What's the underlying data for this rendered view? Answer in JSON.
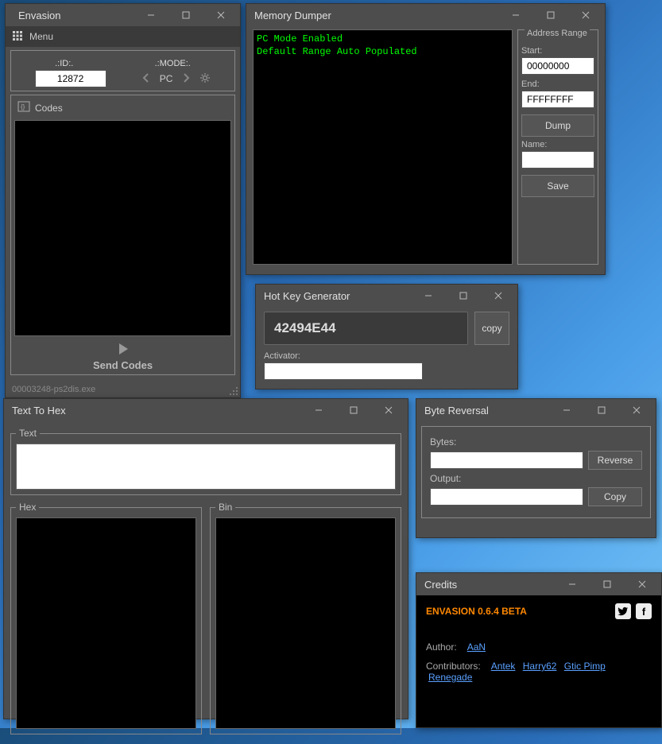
{
  "envasion": {
    "title": "Envasion",
    "menu": "Menu",
    "id_label": ".:ID:.",
    "mode_label": ".:MODE:.",
    "id_value": "12872",
    "mode_value": "PC",
    "codes_label": "Codes",
    "send_label": "Send Codes",
    "status": "00003248-ps2dis.exe"
  },
  "memdump": {
    "title": "Memory Dumper",
    "console_line1": "PC Mode Enabled",
    "console_line2": "Default Range Auto Populated",
    "range_legend": "Address Range",
    "start_label": "Start:",
    "start_value": "00000000",
    "end_label": "End:",
    "end_value": "FFFFFFFF",
    "dump_label": "Dump",
    "name_label": "Name:",
    "name_value": "",
    "save_label": "Save"
  },
  "hotkey": {
    "title": "Hot Key Generator",
    "value": "42494E44",
    "copy_label": "copy",
    "activator_label": "Activator:",
    "activator_value": ""
  },
  "txthex": {
    "title": "Text To Hex",
    "text_legend": "Text",
    "hex_legend": "Hex",
    "bin_legend": "Bin"
  },
  "byterev": {
    "title": "Byte Reversal",
    "bytes_label": "Bytes:",
    "bytes_value": "",
    "reverse_label": "Reverse",
    "output_label": "Output:",
    "output_value": "",
    "copy_label": "Copy"
  },
  "credits": {
    "title": "Credits",
    "app_title": "ENVASION 0.6.4 BETA",
    "author_label": "Author:",
    "author_name": "AaN",
    "contrib_label": "Contributors:",
    "contribs": [
      "Antek",
      "Harry62",
      "Gtic Pimp",
      "Renegade"
    ]
  }
}
